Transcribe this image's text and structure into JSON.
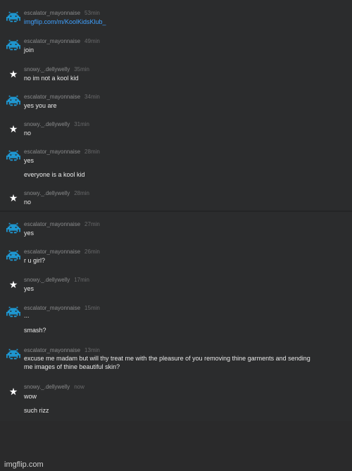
{
  "messages": [
    {
      "user": "escalator_mayonnaise",
      "time": "53min",
      "avatar": "space-invader-icon",
      "lines": [
        "imgflip.com/m/KoolKidsKlub_"
      ],
      "link": true
    },
    {
      "user": "escalator_mayonnaise",
      "time": "49min",
      "avatar": "space-invader-icon",
      "lines": [
        "join"
      ]
    },
    {
      "user": "snowy._.dellywelly",
      "time": "35min",
      "avatar": "star-icon",
      "lines": [
        "no im not a kool kid"
      ]
    },
    {
      "user": "escalator_mayonnaise",
      "time": "34min",
      "avatar": "space-invader-icon",
      "lines": [
        "yes you are"
      ]
    },
    {
      "user": "snowy._.dellywelly",
      "time": "31min",
      "avatar": "star-icon",
      "lines": [
        "no"
      ]
    },
    {
      "user": "escalator_mayonnaise",
      "time": "28min",
      "avatar": "space-invader-icon",
      "lines": [
        "yes",
        "everyone is a kool kid"
      ]
    },
    {
      "user": "snowy._.dellywelly",
      "time": "28min",
      "avatar": "star-icon",
      "lines": [
        "no"
      ]
    },
    {
      "user": "escalator_mayonnaise",
      "time": "27min",
      "avatar": "space-invader-icon",
      "lines": [
        "yes"
      ]
    },
    {
      "user": "escalator_mayonnaise",
      "time": "26min",
      "avatar": "space-invader-icon",
      "lines": [
        "r u girl?"
      ]
    },
    {
      "user": "snowy._.dellywelly",
      "time": "17min",
      "avatar": "star-icon",
      "lines": [
        "yes"
      ]
    },
    {
      "user": "escalator_mayonnaise",
      "time": "15min",
      "avatar": "space-invader-icon",
      "lines": [
        "...",
        "smash?"
      ]
    },
    {
      "user": "escalator_mayonnaise",
      "time": "13min",
      "avatar": "space-invader-icon",
      "lines": [
        "excuse me madam but will thy treat me with the pleasure of you removing thine garments and sending",
        "me images of thine beautiful skin?"
      ]
    },
    {
      "user": "snowy._.dellywelly",
      "time": "now",
      "avatar": "star-icon",
      "lines": [
        "wow",
        "such rizz"
      ]
    }
  ],
  "watermark": "imgflip.com",
  "colors": {
    "invader": "#1e9bd7",
    "link": "#3fa1ff",
    "background": "#2b2c2d"
  }
}
